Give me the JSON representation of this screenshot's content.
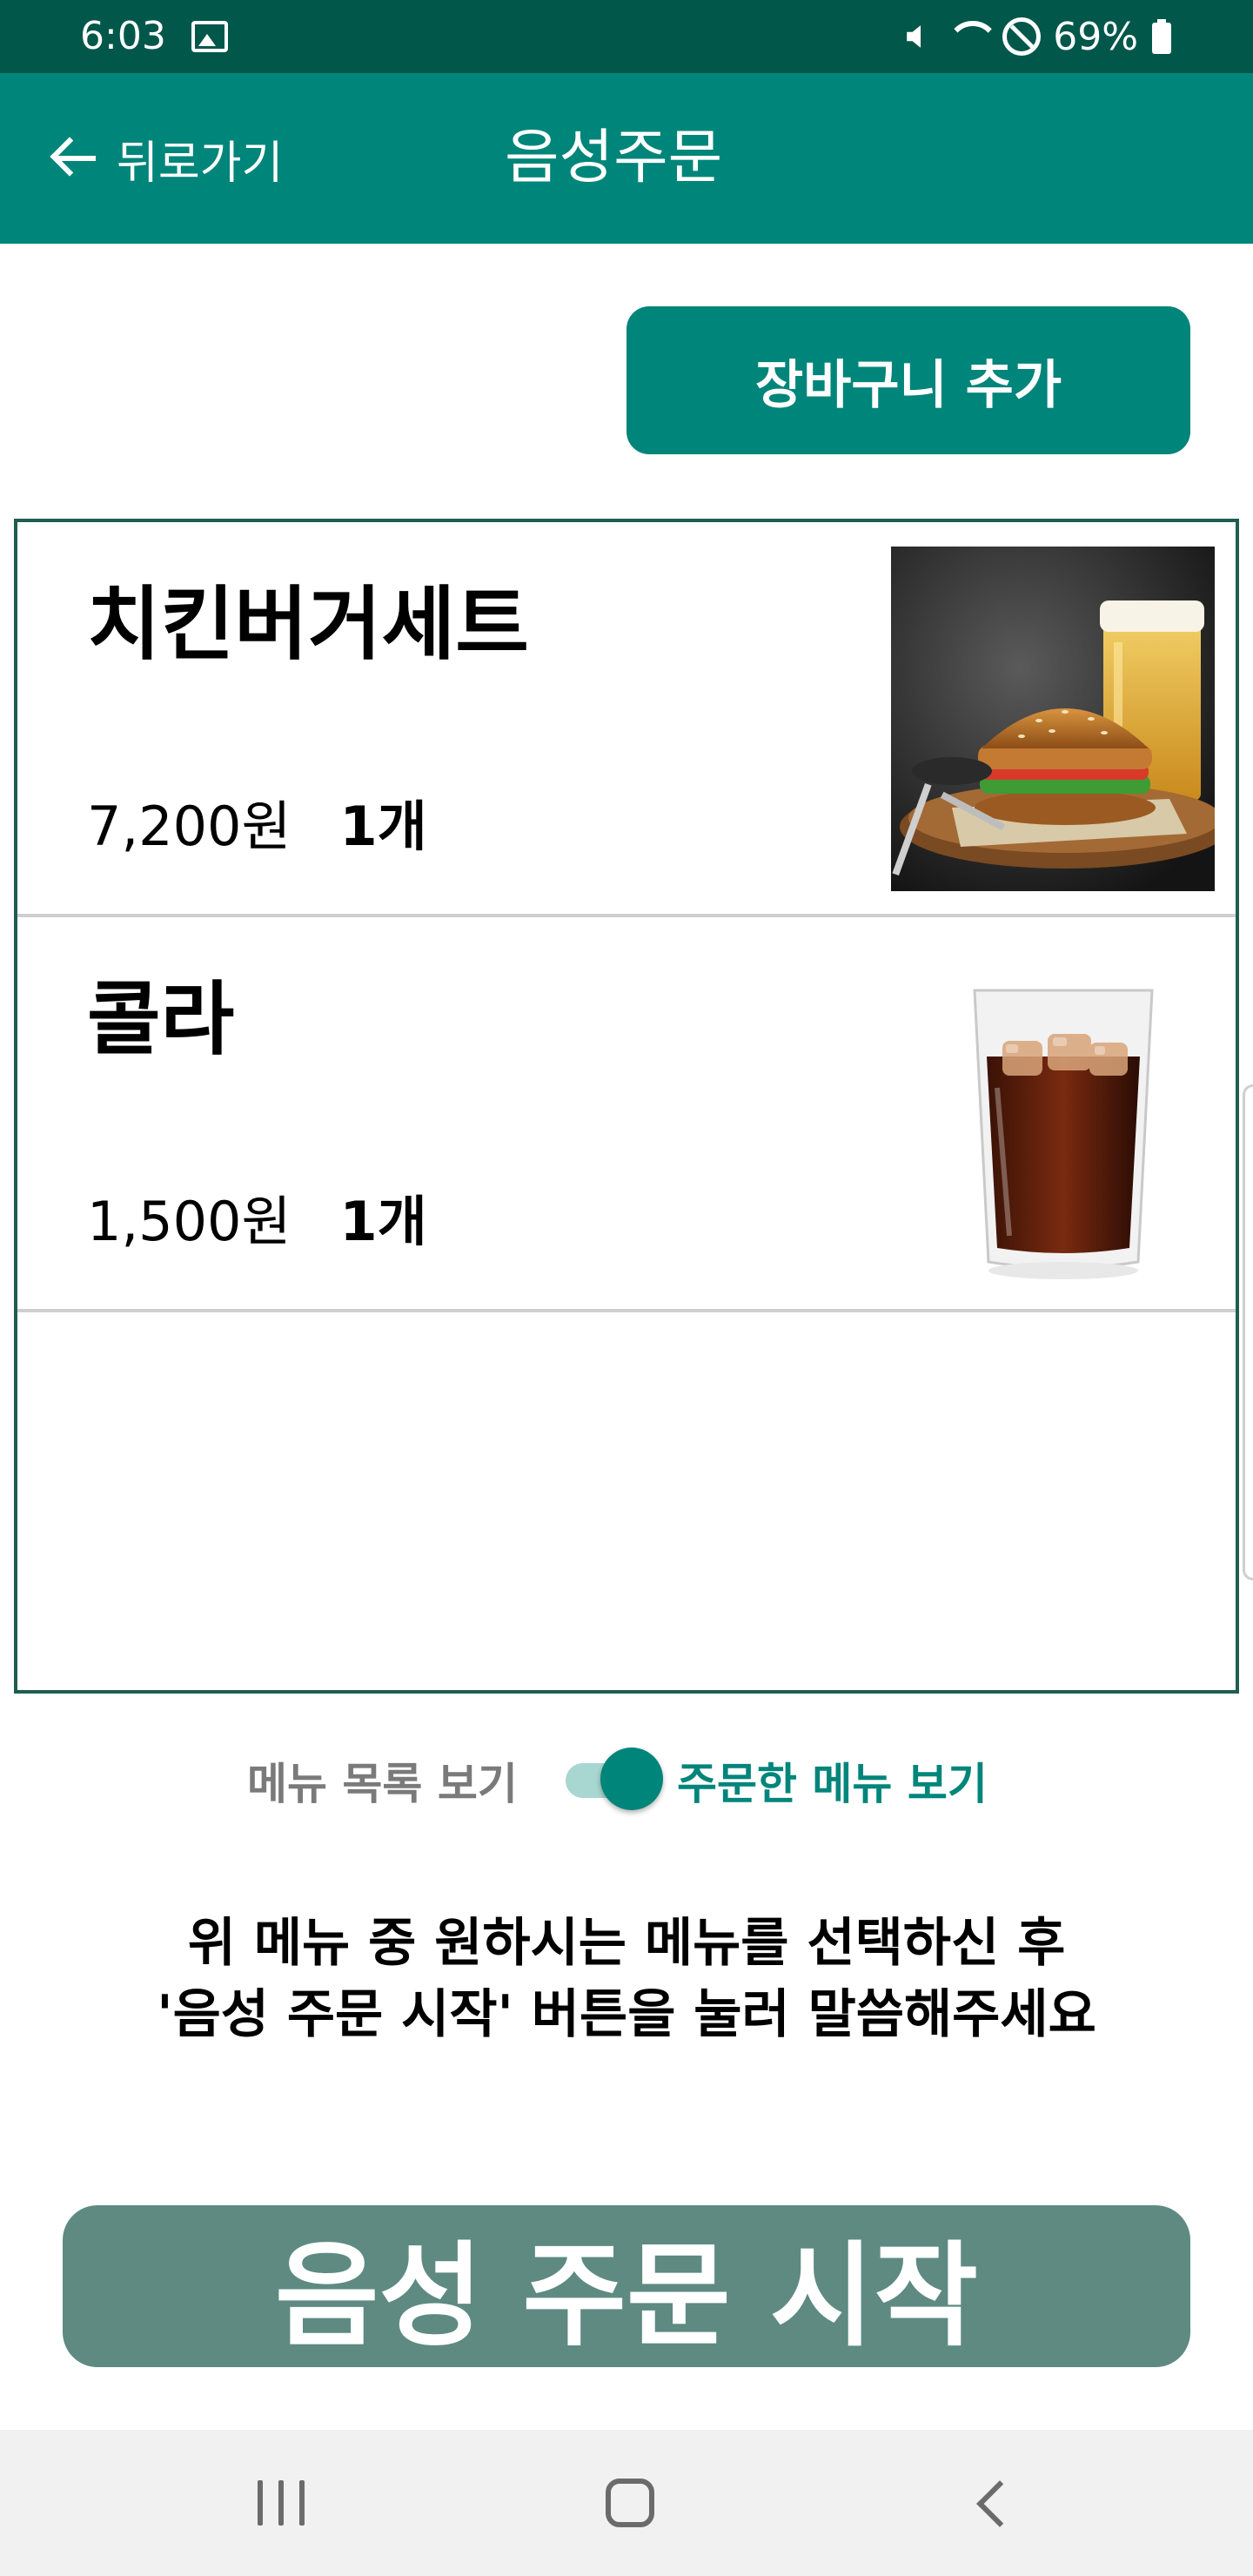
{
  "status_bar": {
    "time": "6:03",
    "battery": "69%",
    "icons": [
      "gallery-icon",
      "mute-icon",
      "wifi-icon",
      "block-icon",
      "battery-icon"
    ]
  },
  "app_bar": {
    "back_label": "뒤로가기",
    "title": "음성주문"
  },
  "cart_button": {
    "label": "장바구니 추가"
  },
  "order_items": [
    {
      "name": "치킨버거세트",
      "price": "7,200원",
      "quantity": "1개",
      "image": "chicken-burger-set-photo"
    },
    {
      "name": "콜라",
      "price": "1,500원",
      "quantity": "1개",
      "image": "cola-glass-photo"
    }
  ],
  "toggle": {
    "left_label": "메뉴 목록 보기",
    "right_label": "주문한 메뉴 보기",
    "checked": true
  },
  "instruction": {
    "line1": "위 메뉴 중 원하시는 메뉴를 선택하신 후",
    "line2": "'음성 주문 시작' 버튼을 눌러 말씀해주세요"
  },
  "start_button": {
    "label": "음성 주문 시작"
  },
  "colors": {
    "status_bar": "#02574b",
    "accent": "#00857a",
    "start_button": "#5e8a82",
    "list_border": "#1f5d4f",
    "toggle_track": "#a8d6d0"
  }
}
